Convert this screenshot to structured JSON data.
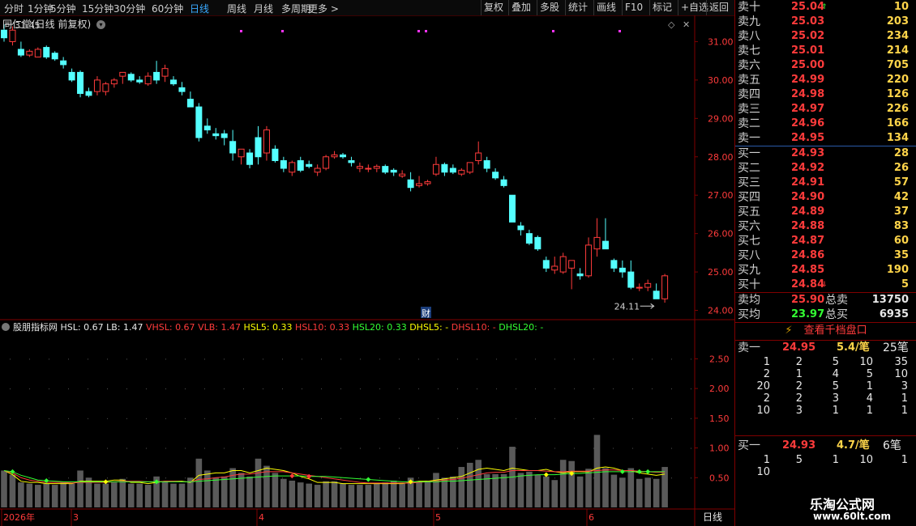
{
  "toolbar": {
    "periods": [
      "分时",
      "1分钟",
      "5分钟",
      "15分钟",
      "30分钟",
      "60分钟",
      "日线",
      "周线",
      "月线",
      "多周期",
      "更多 >"
    ],
    "active_period": "日线",
    "buttons": [
      "复权",
      "叠加",
      "多股",
      "统计",
      "画线",
      "F10",
      "标记",
      "+自选",
      "返回"
    ]
  },
  "main_chart": {
    "title": "同仁堂(日线 前复权)",
    "high_label": "31.45",
    "low_label": "24.11",
    "event_marker": "财",
    "yticks": [
      "31.00",
      "30.00",
      "29.00",
      "28.00",
      "27.00",
      "26.00",
      "25.00",
      "24.00"
    ]
  },
  "indicator": {
    "name": "股朋指标网",
    "items": [
      {
        "label": "HSL: 0.67",
        "color": "#e8e8e8"
      },
      {
        "label": "LB: 1.47",
        "color": "#e8e8e8"
      },
      {
        "label": "VHSL: 0.67",
        "color": "#ff3b3b"
      },
      {
        "label": "VLB: 1.47",
        "color": "#ff3b3b"
      },
      {
        "label": "HSL5: 0.33",
        "color": "#ffff00"
      },
      {
        "label": "HSL10: 0.33",
        "color": "#ff3b3b"
      },
      {
        "label": "HSL20: 0.33",
        "color": "#33ff33"
      },
      {
        "label": "DHSL5: -",
        "color": "#ffff00"
      },
      {
        "label": "DHSL10: -",
        "color": "#ff3b3b"
      },
      {
        "label": "DHSL20: -",
        "color": "#33ff33"
      }
    ],
    "yticks": [
      "2.50",
      "2.00",
      "1.50",
      "1.00",
      "0.50"
    ]
  },
  "time_axis": {
    "labels": [
      "2026年",
      "3",
      "4",
      "5",
      "6"
    ],
    "period_label": "日线"
  },
  "chart_data": {
    "type": "candlestick",
    "ylim": [
      23.8,
      31.6
    ],
    "candles": [
      [
        31.3,
        31.45,
        31.0,
        31.1
      ],
      [
        31.0,
        31.4,
        30.9,
        31.3
      ],
      [
        30.8,
        31.0,
        30.6,
        30.65
      ],
      [
        30.65,
        30.8,
        30.6,
        30.75
      ],
      [
        30.6,
        30.85,
        30.6,
        30.8
      ],
      [
        30.85,
        30.9,
        30.55,
        30.6
      ],
      [
        30.7,
        30.75,
        30.5,
        30.55
      ],
      [
        30.5,
        30.6,
        30.3,
        30.4
      ],
      [
        30.2,
        30.3,
        29.95,
        30.0
      ],
      [
        30.2,
        30.25,
        29.55,
        29.65
      ],
      [
        29.7,
        29.8,
        29.55,
        29.6
      ],
      [
        29.7,
        30.1,
        29.6,
        30.0
      ],
      [
        29.7,
        29.95,
        29.6,
        29.9
      ],
      [
        29.9,
        30.05,
        29.8,
        30.0
      ],
      [
        30.1,
        30.2,
        29.9,
        30.2
      ],
      [
        30.15,
        30.2,
        29.95,
        30.0
      ],
      [
        30.0,
        30.1,
        29.9,
        29.95
      ],
      [
        29.9,
        30.2,
        29.85,
        30.1
      ],
      [
        30.2,
        30.5,
        29.9,
        30.0
      ],
      [
        30.1,
        30.4,
        29.95,
        30.3
      ],
      [
        30.0,
        30.1,
        29.85,
        29.9
      ],
      [
        29.8,
        29.95,
        29.6,
        29.7
      ],
      [
        29.5,
        29.7,
        29.3,
        29.3
      ],
      [
        29.3,
        29.4,
        28.4,
        28.5
      ],
      [
        28.8,
        29.0,
        28.6,
        28.7
      ],
      [
        28.6,
        28.75,
        28.45,
        28.55
      ],
      [
        28.6,
        28.7,
        28.3,
        28.5
      ],
      [
        28.4,
        28.7,
        27.9,
        28.1
      ],
      [
        28.0,
        28.2,
        27.8,
        28.2
      ],
      [
        28.1,
        28.2,
        27.7,
        27.8
      ],
      [
        28.5,
        28.8,
        27.8,
        28.0
      ],
      [
        28.1,
        28.8,
        27.9,
        28.7
      ],
      [
        28.2,
        28.3,
        27.85,
        27.9
      ],
      [
        27.9,
        28.0,
        27.6,
        27.7
      ],
      [
        27.6,
        27.9,
        27.5,
        27.85
      ],
      [
        27.9,
        28.0,
        27.6,
        27.65
      ],
      [
        27.8,
        27.9,
        27.7,
        27.75
      ],
      [
        27.6,
        27.8,
        27.5,
        27.7
      ],
      [
        27.7,
        28.05,
        27.65,
        28.0
      ],
      [
        28.0,
        28.15,
        27.95,
        28.05
      ],
      [
        28.05,
        28.1,
        27.95,
        28.0
      ],
      [
        27.9,
        28.0,
        27.75,
        27.85
      ],
      [
        27.7,
        27.85,
        27.6,
        27.75
      ],
      [
        27.7,
        27.8,
        27.6,
        27.7
      ],
      [
        27.7,
        27.8,
        27.6,
        27.75
      ],
      [
        27.75,
        27.8,
        27.55,
        27.6
      ],
      [
        27.65,
        27.7,
        27.5,
        27.6
      ],
      [
        27.5,
        27.65,
        27.45,
        27.55
      ],
      [
        27.4,
        27.6,
        27.1,
        27.2
      ],
      [
        27.25,
        27.5,
        27.2,
        27.3
      ],
      [
        27.3,
        27.4,
        27.25,
        27.35
      ],
      [
        27.55,
        28.0,
        27.5,
        27.8
      ],
      [
        27.8,
        27.85,
        27.5,
        27.6
      ],
      [
        27.7,
        27.8,
        27.55,
        27.6
      ],
      [
        27.55,
        27.7,
        27.5,
        27.65
      ],
      [
        27.6,
        27.85,
        27.55,
        27.85
      ],
      [
        27.9,
        28.4,
        27.8,
        28.1
      ],
      [
        27.9,
        28.0,
        27.6,
        27.7
      ],
      [
        27.6,
        27.7,
        27.4,
        27.45
      ],
      [
        27.4,
        27.5,
        27.2,
        27.25
      ],
      [
        27.0,
        27.0,
        26.3,
        26.3
      ],
      [
        26.2,
        26.3,
        25.95,
        26.1
      ],
      [
        26.0,
        26.1,
        25.7,
        25.75
      ],
      [
        25.9,
        25.95,
        25.55,
        25.6
      ],
      [
        25.3,
        25.4,
        25.0,
        25.1
      ],
      [
        25.05,
        25.4,
        24.95,
        25.15
      ],
      [
        25.0,
        25.5,
        24.95,
        25.4
      ],
      [
        25.1,
        25.2,
        24.55,
        25.3
      ],
      [
        24.95,
        25.1,
        24.8,
        24.9
      ],
      [
        24.9,
        25.9,
        24.85,
        25.7
      ],
      [
        25.6,
        26.4,
        25.4,
        25.9
      ],
      [
        25.8,
        26.4,
        25.6,
        25.6
      ],
      [
        25.3,
        25.35,
        25.0,
        25.1
      ],
      [
        25.1,
        25.3,
        24.85,
        25.0
      ],
      [
        25.0,
        25.3,
        24.55,
        24.6
      ],
      [
        24.6,
        24.7,
        24.5,
        24.6
      ],
      [
        24.6,
        24.8,
        24.5,
        24.7
      ],
      [
        24.5,
        24.7,
        24.3,
        24.3
      ],
      [
        24.3,
        24.95,
        24.2,
        24.9
      ]
    ],
    "volume": [
      0.62,
      0.55,
      0.42,
      0.4,
      0.38,
      0.4,
      0.38,
      0.42,
      0.4,
      0.62,
      0.5,
      0.4,
      0.4,
      0.42,
      0.48,
      0.4,
      0.4,
      0.38,
      0.52,
      0.44,
      0.4,
      0.4,
      0.5,
      0.82,
      0.62,
      0.5,
      0.52,
      0.66,
      0.58,
      0.52,
      0.82,
      0.7,
      0.58,
      0.48,
      0.45,
      0.42,
      0.4,
      0.38,
      0.44,
      0.44,
      0.4,
      0.38,
      0.38,
      0.38,
      0.4,
      0.42,
      0.45,
      0.4,
      0.5,
      0.44,
      0.45,
      0.58,
      0.5,
      0.52,
      0.68,
      0.75,
      0.8,
      0.56,
      0.56,
      0.56,
      1.02,
      0.58,
      0.6,
      0.55,
      0.52,
      0.46,
      0.8,
      0.78,
      0.52,
      0.65,
      1.22,
      0.66,
      0.55,
      0.5,
      0.66,
      0.48,
      0.5,
      0.48,
      0.68
    ],
    "ma_lines": [
      {
        "color": "#ffff00",
        "values": [
          0.62,
          0.55,
          0.44,
          0.42,
          0.42,
          0.4,
          0.4,
          0.4,
          0.4,
          0.44,
          0.44,
          0.44,
          0.44,
          0.46,
          0.46,
          0.42,
          0.42,
          0.4,
          0.42,
          0.44,
          0.44,
          0.44,
          0.42,
          0.54,
          0.56,
          0.58,
          0.58,
          0.62,
          0.62,
          0.58,
          0.62,
          0.66,
          0.64,
          0.62,
          0.58,
          0.52,
          0.48,
          0.42,
          0.42,
          0.42,
          0.4,
          0.4,
          0.4,
          0.4,
          0.4,
          0.4,
          0.4,
          0.4,
          0.42,
          0.44,
          0.44,
          0.46,
          0.48,
          0.5,
          0.52,
          0.58,
          0.64,
          0.66,
          0.64,
          0.62,
          0.66,
          0.64,
          0.62,
          0.62,
          0.64,
          0.6,
          0.58,
          0.6,
          0.6,
          0.6,
          0.66,
          0.68,
          0.66,
          0.62,
          0.62,
          0.58,
          0.56,
          0.54,
          0.56
        ]
      },
      {
        "color": "#ff3b3b",
        "values": [
          0.62,
          0.58,
          0.5,
          0.46,
          0.44,
          0.42,
          0.42,
          0.42,
          0.41,
          0.42,
          0.42,
          0.42,
          0.42,
          0.43,
          0.44,
          0.44,
          0.44,
          0.43,
          0.43,
          0.44,
          0.44,
          0.43,
          0.43,
          0.47,
          0.48,
          0.5,
          0.51,
          0.54,
          0.56,
          0.56,
          0.58,
          0.6,
          0.6,
          0.6,
          0.58,
          0.56,
          0.54,
          0.52,
          0.5,
          0.48,
          0.46,
          0.44,
          0.42,
          0.41,
          0.41,
          0.41,
          0.41,
          0.41,
          0.41,
          0.42,
          0.43,
          0.44,
          0.46,
          0.47,
          0.49,
          0.52,
          0.55,
          0.58,
          0.59,
          0.59,
          0.62,
          0.62,
          0.62,
          0.62,
          0.61,
          0.6,
          0.6,
          0.61,
          0.61,
          0.61,
          0.62,
          0.63,
          0.63,
          0.62,
          0.62,
          0.61,
          0.6,
          0.59,
          0.59
        ]
      },
      {
        "color": "#33ff33",
        "values": [
          0.62,
          0.6,
          0.54,
          0.5,
          0.46,
          0.45,
          0.44,
          0.43,
          0.43,
          0.43,
          0.43,
          0.43,
          0.43,
          0.43,
          0.43,
          0.43,
          0.43,
          0.43,
          0.43,
          0.43,
          0.43,
          0.43,
          0.43,
          0.44,
          0.45,
          0.46,
          0.47,
          0.48,
          0.49,
          0.5,
          0.51,
          0.52,
          0.53,
          0.53,
          0.53,
          0.53,
          0.52,
          0.52,
          0.52,
          0.51,
          0.5,
          0.49,
          0.48,
          0.47,
          0.46,
          0.45,
          0.44,
          0.43,
          0.43,
          0.43,
          0.43,
          0.43,
          0.44,
          0.44,
          0.45,
          0.46,
          0.47,
          0.48,
          0.49,
          0.5,
          0.51,
          0.53,
          0.54,
          0.55,
          0.55,
          0.55,
          0.56,
          0.57,
          0.57,
          0.58,
          0.59,
          0.6,
          0.6,
          0.6,
          0.6,
          0.6,
          0.6,
          0.6,
          0.6
        ]
      }
    ]
  },
  "order_book": {
    "asks": [
      {
        "label": "卖十",
        "price": "25.04",
        "vol": "10",
        "arrow": "up"
      },
      {
        "label": "卖九",
        "price": "25.03",
        "vol": "203"
      },
      {
        "label": "卖八",
        "price": "25.02",
        "vol": "234"
      },
      {
        "label": "卖七",
        "price": "25.01",
        "vol": "214"
      },
      {
        "label": "卖六",
        "price": "25.00",
        "vol": "705"
      },
      {
        "label": "卖五",
        "price": "24.99",
        "vol": "220"
      },
      {
        "label": "卖四",
        "price": "24.98",
        "vol": "126"
      },
      {
        "label": "卖三",
        "price": "24.97",
        "vol": "226"
      },
      {
        "label": "卖二",
        "price": "24.96",
        "vol": "166"
      },
      {
        "label": "卖一",
        "price": "24.95",
        "vol": "134"
      }
    ],
    "bids": [
      {
        "label": "买一",
        "price": "24.93",
        "vol": "28"
      },
      {
        "label": "买二",
        "price": "24.92",
        "vol": "26"
      },
      {
        "label": "买三",
        "price": "24.91",
        "vol": "57"
      },
      {
        "label": "买四",
        "price": "24.90",
        "vol": "42"
      },
      {
        "label": "买五",
        "price": "24.89",
        "vol": "37"
      },
      {
        "label": "买六",
        "price": "24.88",
        "vol": "83"
      },
      {
        "label": "买七",
        "price": "24.87",
        "vol": "60"
      },
      {
        "label": "买八",
        "price": "24.86",
        "vol": "35"
      },
      {
        "label": "买九",
        "price": "24.85",
        "vol": "190"
      },
      {
        "label": "买十",
        "price": "24.84",
        "vol": "5",
        "arrow": "down"
      }
    ],
    "summary": {
      "ask_avg_label": "卖均",
      "ask_avg": "25.90",
      "ask_total_label": "总卖",
      "ask_total": "13750",
      "bid_avg_label": "买均",
      "bid_avg": "23.97",
      "bid_total_label": "总买",
      "bid_total": "6935"
    },
    "view_thousand_label": "查看千档盘口",
    "ask1_detail": {
      "label": "卖一",
      "price": "24.95",
      "avg": "5.4/笔",
      "count": "25笔",
      "rows": [
        [
          "1",
          "2",
          "5",
          "10",
          "35"
        ],
        [
          "2",
          "1",
          "4",
          "5",
          "10"
        ],
        [
          "20",
          "2",
          "5",
          "1",
          "3"
        ],
        [
          "2",
          "2",
          "3",
          "4",
          "1"
        ],
        [
          "10",
          "3",
          "1",
          "1",
          "1"
        ]
      ]
    },
    "bid1_detail": {
      "label": "买一",
      "price": "24.93",
      "avg": "4.7/笔",
      "count": "6笔",
      "rows": [
        [
          "1",
          "5",
          "1",
          "10",
          "1"
        ],
        [
          "10",
          "",
          "",
          "",
          ""
        ]
      ]
    }
  },
  "watermark": {
    "line1": "乐淘公式网",
    "line2": "www.60lt.com"
  }
}
